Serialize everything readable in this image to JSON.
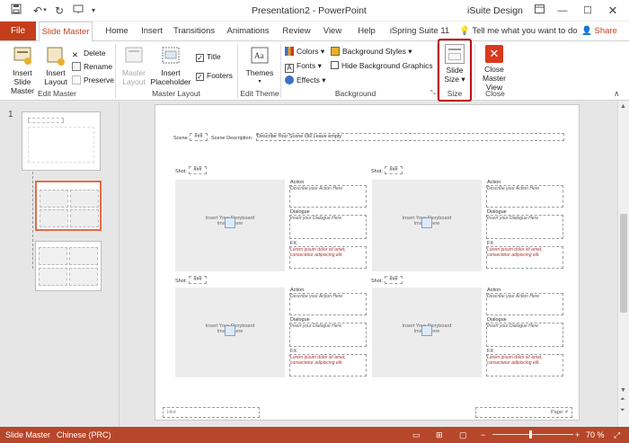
{
  "titlebar": {
    "doc_title": "Presentation2  -  PowerPoint",
    "user_name": "iSuite Design",
    "save_icon": "save-icon",
    "undo_icon": "undo-icon",
    "redo_icon": "redo-icon",
    "present_icon": "present-from-start-icon"
  },
  "tabs": {
    "file": "File",
    "items": [
      "Slide Master",
      "Home",
      "Insert",
      "Transitions",
      "Animations",
      "Review",
      "View",
      "Help",
      "iSpring Suite 11"
    ],
    "tell_me": "Tell me what you want to do",
    "share": "Share"
  },
  "ribbon": {
    "edit_master": {
      "label": "Edit Master",
      "insert_slide_master": "Insert Slide Master",
      "insert_layout": "Insert Layout",
      "delete": "Delete",
      "rename": "Rename",
      "preserve": "Preserve"
    },
    "master_layout": {
      "label": "Master Layout",
      "master_layout": "Master Layout",
      "insert_placeholder": "Insert Placeholder",
      "title": "Title",
      "footers": "Footers"
    },
    "edit_theme": {
      "label": "Edit Theme",
      "themes": "Themes"
    },
    "background": {
      "label": "Background",
      "colors": "Colors",
      "fonts": "Fonts",
      "effects": "Effects",
      "background_styles": "Background Styles",
      "hide_background_graphics": "Hide Background Graphics"
    },
    "size": {
      "label": "Size",
      "slide_size_line1": "Slide",
      "slide_size_line2": "Size"
    },
    "close": {
      "label": "Close",
      "close_line1": "Close",
      "close_line2": "Master View"
    }
  },
  "thumbs": {
    "slide_number": "1"
  },
  "slide": {
    "scene_label": "Scene:",
    "scene_value": "###",
    "scene_desc_label": "Scene Description:",
    "scene_desc_value": "Describe Your Scene OR Leave empty",
    "shot_label": "Shot:",
    "shot_value": "###",
    "action_label": "Action",
    "action_text": "Describe your Action Here",
    "dialogue_label": "Dialogue",
    "dialogue_text": "Insert your Dialogue Here",
    "fx_label": "FX",
    "fx_text": "Lorem ipsum dolor sit amet, consectetur adipiscing elit.",
    "storyboard_text": "Insert Your Storyboard Image Here",
    "footer_left": "Hint",
    "footer_right": "Page: #"
  },
  "statusbar": {
    "mode": "Slide Master",
    "language": "Chinese (PRC)",
    "zoom": "70 %"
  },
  "colors": {
    "accent": "#c43e1c",
    "status_bar": "#b7472a",
    "highlight": "#c00000"
  }
}
